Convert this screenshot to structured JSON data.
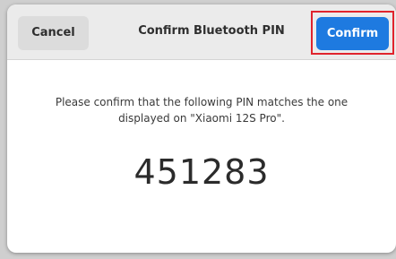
{
  "dialog": {
    "title": "Confirm Bluetooth PIN",
    "cancel_label": "Cancel",
    "confirm_label": "Confirm",
    "message": "Please confirm that the following PIN matches the one displayed on \"Xiaomi 12S Pro\".",
    "pin": "451283"
  },
  "colors": {
    "accent": "#1e7ae0",
    "highlight_outline": "#e0242d",
    "headerbar": "#ebebeb",
    "dialog_background": "#ffffff"
  }
}
